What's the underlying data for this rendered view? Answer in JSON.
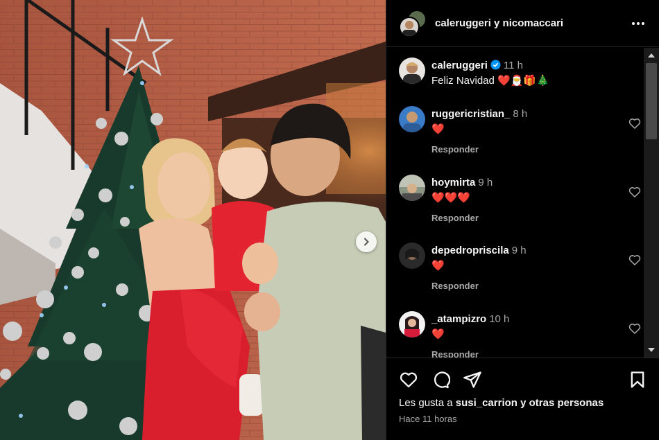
{
  "colors": {
    "background": "#000000",
    "text": "#f5f5f5",
    "muted": "#a8a8a8",
    "heart": "#ff3040",
    "verified": "#0095f6"
  },
  "header": {
    "title": "caleruggeri y nicomaccari",
    "more_icon": "more-horizontal-icon"
  },
  "photo": {
    "alt_icon": "family-christmas-photo",
    "next_icon": "chevron-right-icon"
  },
  "caption": {
    "username": "caleruggeri",
    "verified": true,
    "time": "11 h",
    "text": "Feliz Navidad ",
    "emojis": "❤️🎅🎁🎄"
  },
  "comments": [
    {
      "username": "ruggericristian_",
      "time": "8 h",
      "text": "❤️",
      "reply": "Responder"
    },
    {
      "username": "hoymirta",
      "time": "9 h",
      "text": "❤️❤️❤️",
      "reply": "Responder"
    },
    {
      "username": "depedropriscila",
      "time": "9 h",
      "text": "❤️",
      "reply": "Responder"
    },
    {
      "username": "_atampizro",
      "time": "10 h",
      "text": "❤️",
      "reply": "Responder"
    }
  ],
  "actions": {
    "like_icon": "heart-icon",
    "comment_icon": "comment-icon",
    "share_icon": "send-icon",
    "save_icon": "bookmark-icon"
  },
  "likes": {
    "prefix": "Les gusta a ",
    "user": "susi_carrion",
    "suffix": " y otras personas"
  },
  "timestamp": "Hace 11 horas"
}
